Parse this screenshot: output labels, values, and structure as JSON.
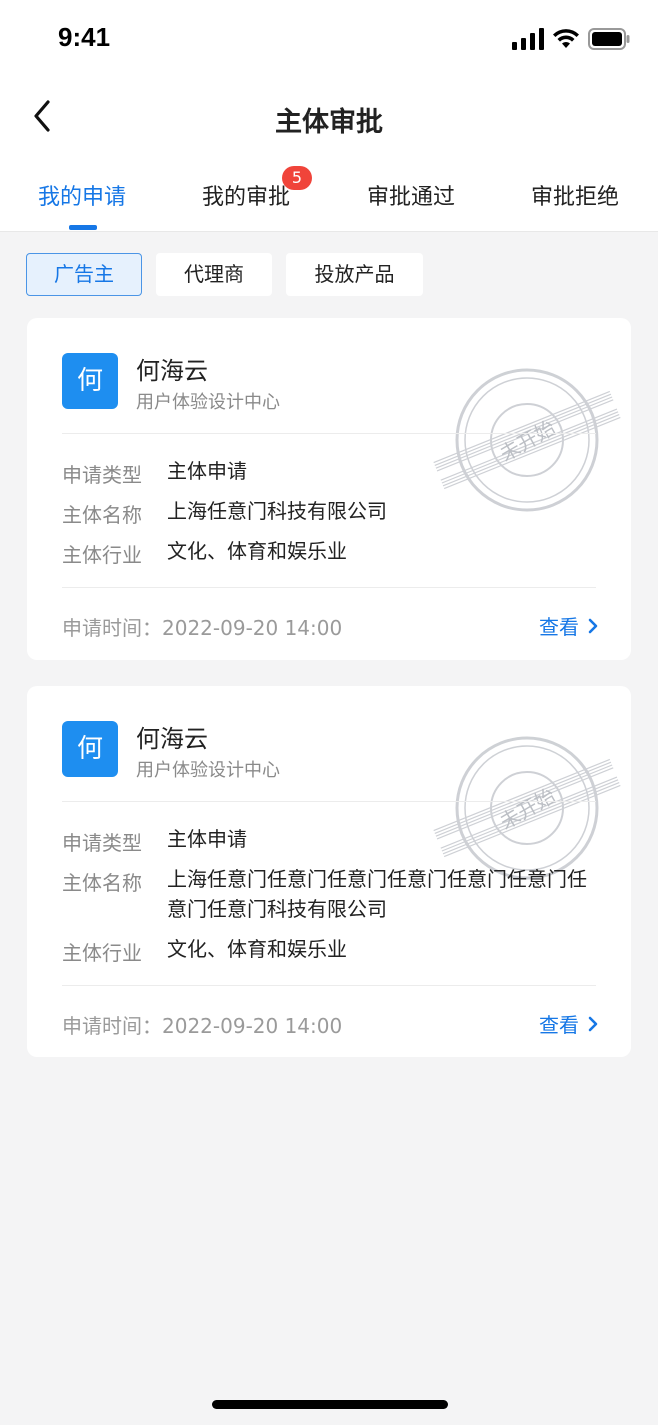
{
  "status_bar": {
    "time": "9:41"
  },
  "nav": {
    "title": "主体审批"
  },
  "tabs": [
    {
      "label": "我的申请",
      "active": true
    },
    {
      "label": "我的审批",
      "badge": "5"
    },
    {
      "label": "审批通过"
    },
    {
      "label": "审批拒绝"
    }
  ],
  "filters": [
    {
      "label": "广告主",
      "active": true
    },
    {
      "label": "代理商"
    },
    {
      "label": "投放产品"
    }
  ],
  "cards": [
    {
      "avatar_char": "何",
      "name": "何海云",
      "dept": "用户体验设计中心",
      "stamp_text": "未开始",
      "fields": [
        {
          "label": "申请类型",
          "value": "主体申请"
        },
        {
          "label": "主体名称",
          "value": "上海任意门科技有限公司"
        },
        {
          "label": "主体行业",
          "value": "文化、体育和娱乐业"
        }
      ],
      "time": "申请时间：2022-09-20 14:00",
      "view_label": "查看"
    },
    {
      "avatar_char": "何",
      "name": "何海云",
      "dept": "用户体验设计中心",
      "stamp_text": "未开始",
      "fields": [
        {
          "label": "申请类型",
          "value": "主体申请"
        },
        {
          "label": "主体名称",
          "value": "上海任意门任意门任意门任意门任意门任意门任意门任意门科技有限公司"
        },
        {
          "label": "主体行业",
          "value": "文化、体育和娱乐业"
        }
      ],
      "time": "申请时间：2022-09-20 14:00",
      "view_label": "查看"
    }
  ],
  "colors": {
    "accent": "#1677e6",
    "badge": "#f0443a",
    "avatar": "#1e8ef0"
  }
}
